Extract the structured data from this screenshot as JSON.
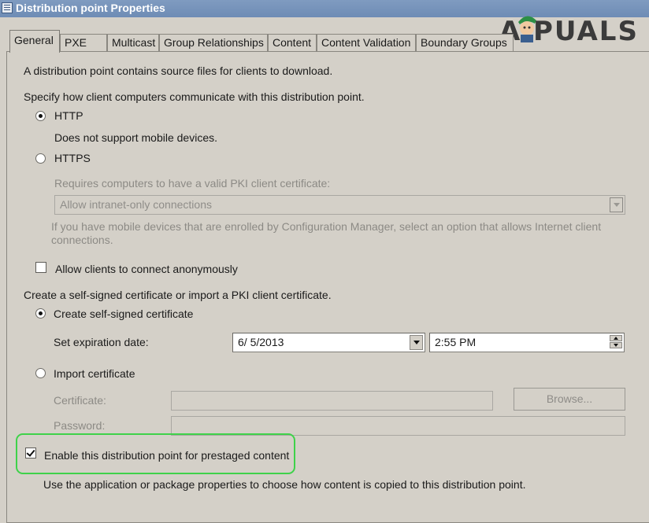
{
  "window": {
    "title": "Distribution point Properties"
  },
  "tabs": [
    "General",
    "PXE",
    "Multicast",
    "Group Relationships",
    "Content",
    "Content Validation",
    "Boundary Groups"
  ],
  "watermark": {
    "text": "PUALS",
    "lead_letter": "A"
  },
  "general": {
    "intro": "A distribution point contains source files for clients to download.",
    "comm_prompt": "Specify how client computers communicate with this distribution point.",
    "http": {
      "label": "HTTP",
      "checked": true,
      "note": "Does not support mobile devices."
    },
    "https": {
      "label": "HTTPS",
      "checked": false,
      "requires_label": "Requires computers to have a valid PKI client certificate:",
      "connection_value": "Allow intranet-only connections",
      "mobile_note_line1": "If you have mobile devices that are enrolled by Configuration Manager, select an option that allows Internet client",
      "mobile_note_line2": "connections."
    },
    "anonymous": {
      "label": "Allow clients to connect anonymously",
      "checked": false
    },
    "cert_prompt": "Create a self-signed certificate or import a PKI client certificate.",
    "self_signed": {
      "label": "Create self-signed certificate",
      "checked": true,
      "expiration_label": "Set expiration date:",
      "date_value": "6/  5/2013",
      "time_value": "2:55 PM"
    },
    "import_cert": {
      "label": "Import certificate",
      "checked": false,
      "certificate_label": "Certificate:",
      "browse_label": "Browse...",
      "password_label": "Password:"
    },
    "prestaged": {
      "label": "Enable this distribution point for prestaged content",
      "checked": true,
      "note": "Use the application or package properties to choose how content is copied to this distribution point."
    }
  },
  "colors": {
    "highlight": "#3fd24a",
    "titlebar": "#7090b8",
    "dialog_bg": "#d4d0c8"
  }
}
